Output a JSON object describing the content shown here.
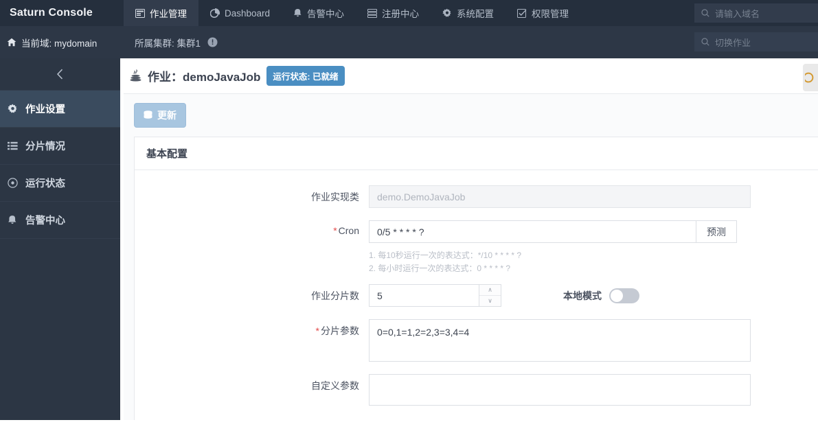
{
  "topnav": {
    "brand": "Saturn Console",
    "items": [
      {
        "label": "作业管理",
        "icon": "window-icon",
        "active": true
      },
      {
        "label": "Dashboard",
        "icon": "pie-chart-icon",
        "active": false
      },
      {
        "label": "告警中心",
        "icon": "bell-icon",
        "active": false
      },
      {
        "label": "注册中心",
        "icon": "server-icon",
        "active": false
      },
      {
        "label": "系统配置",
        "icon": "gear-icon",
        "active": false
      },
      {
        "label": "权限管理",
        "icon": "check-square-icon",
        "active": false
      }
    ],
    "domain_search_placeholder": "请输入域名"
  },
  "subbar": {
    "home_icon": "home-icon",
    "current_domain": "当前域: mydomain",
    "cluster": "所属集群: 集群1",
    "info_icon": "info-circle-icon",
    "job_search_placeholder": "切换作业"
  },
  "sidebar": {
    "collapse_icon": "chevron-left-icon",
    "items": [
      {
        "label": "作业设置",
        "icon": "gear-icon",
        "active": true
      },
      {
        "label": "分片情况",
        "icon": "list-icon",
        "active": false
      },
      {
        "label": "运行状态",
        "icon": "circle-dot-icon",
        "active": false
      },
      {
        "label": "告警中心",
        "icon": "bell-icon",
        "active": false
      }
    ]
  },
  "job_header": {
    "icon": "java-icon",
    "title": "作业：demoJavaJob",
    "status_badge": "运行状态: 已就绪",
    "side_tab_icon": "comment-icon"
  },
  "toolbar": {
    "update_label": "更新",
    "update_icon": "database-icon"
  },
  "panel": {
    "title": "基本配置",
    "fields": {
      "impl_class": {
        "label": "作业实现类",
        "value": "demo.DemoJavaJob",
        "readonly": true
      },
      "cron": {
        "label": "Cron",
        "required": true,
        "value": "0/5 * * * * ?",
        "button": "预测",
        "hints": [
          "1. 每10秒运行一次的表达式：*/10 * * * * ?",
          "2. 每小时运行一次的表达式：0 * * * * ?"
        ]
      },
      "shard_count": {
        "label": "作业分片数",
        "value": "5",
        "stepper_up": "∧",
        "stepper_down": "∨"
      },
      "local_mode": {
        "label": "本地模式",
        "enabled": false
      },
      "shard_params": {
        "label": "分片参数",
        "required": true,
        "value": "0=0,1=1,2=2,3=3,4=4"
      },
      "custom_params": {
        "label": "自定义参数",
        "value": ""
      }
    }
  },
  "colors": {
    "nav_bg": "#252f3d",
    "subbar_bg": "#2d3746",
    "sidebar_bg": "#2c3644",
    "sidebar_active": "#3a4b5e",
    "accent_blue": "#4a8ec2",
    "update_btn": "#a8c6e0",
    "required_red": "#e24a4a",
    "content_bg": "#fafbfc"
  }
}
